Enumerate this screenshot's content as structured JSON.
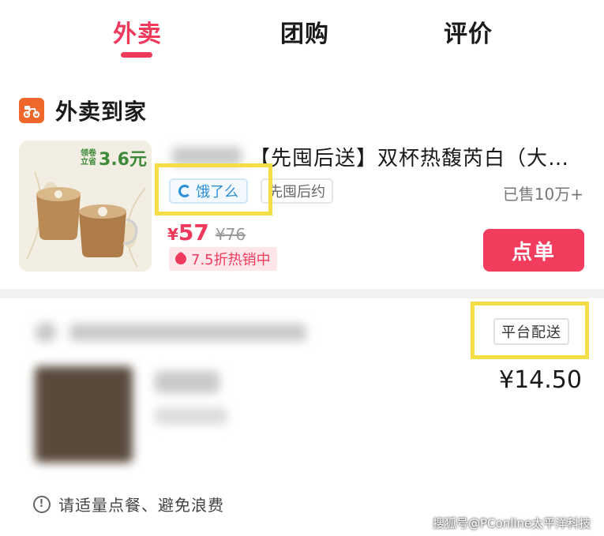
{
  "tabs": [
    {
      "label": "外卖",
      "active": true
    },
    {
      "label": "团购",
      "active": false
    },
    {
      "label": "评价",
      "active": false
    }
  ],
  "section": {
    "icon": "delivery-scooter-icon",
    "title": "外卖到家"
  },
  "product1": {
    "promo_small_line1": "领卷",
    "promo_small_line2": "立省",
    "promo_amount": "3.6元",
    "name": "【先囤后送】双杯热馥芮白（大…",
    "platform_tag": "饿了么",
    "tag2": "先囤后约",
    "sold": "已售10万+",
    "price_symbol": "¥",
    "price": "57",
    "original_price": "¥76",
    "discount": "7.5折热销中",
    "order_button": "点单"
  },
  "product2": {
    "delivery_badge": "平台配送",
    "price": "¥14.50"
  },
  "notice": {
    "icon": "info-icon",
    "text": "请适量点餐、避免浪费"
  },
  "watermark": "搜狐号@PConline太平洋科技",
  "colors": {
    "accent": "#ef3a5d",
    "highlight": "#f4dd45",
    "eleme_blue": "#2a8fd7"
  }
}
